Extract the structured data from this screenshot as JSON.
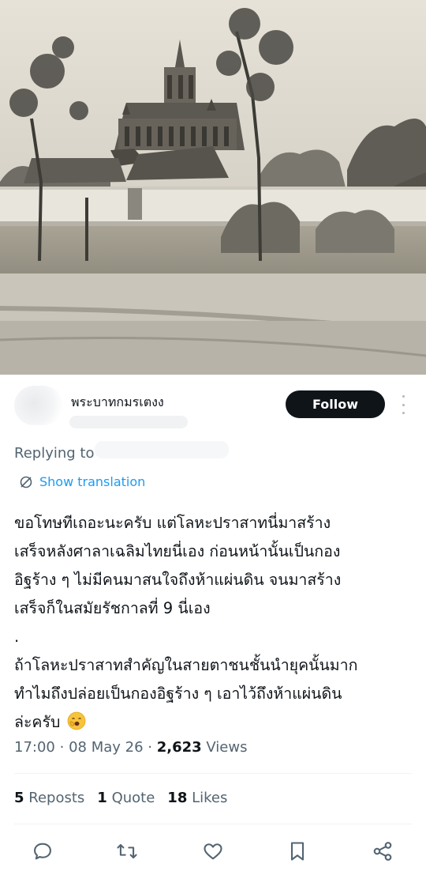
{
  "author": {
    "name": "พระบาทกมรเตงง"
  },
  "follow_label": "Follow",
  "replying_to": "Replying to",
  "show_translation": "Show translation",
  "tweet": {
    "line1": "ขอโทษทีเถอะนะครับ แต่โลหะปราสาทนี่มาสร้าง",
    "line2": "เสร็จหลังศาลาเฉลิมไทยนี่เอง ก่อนหน้านั้นเป็นกอง",
    "line3": "อิฐร้าง ๆ ไม่มีคนมาสนใจถึงห้าแผ่นดิน จนมาสร้าง",
    "line4": "เสร็จก็ในสมัยรัชกาลที่ 9 นี่เอง",
    "line5": ".",
    "line6": "ถ้าโลหะปราสาทสำคัญในสายตาชนชั้นนำยุคนั้นมาก",
    "line7": "ทำไมถึงปล่อยเป็นกองอิฐร้าง ๆ เอาไว้ถึงห้าแผ่นดิน",
    "line8": "ล่ะครับ"
  },
  "meta": {
    "time": "17:00",
    "date": "08 May 26",
    "views_count": "2,623",
    "views_label": "Views"
  },
  "stats": {
    "reposts_count": "5",
    "reposts_label": "Reposts",
    "quotes_count": "1",
    "quotes_label": "Quote",
    "likes_count": "18",
    "likes_label": "Likes"
  },
  "icons": [
    "reply-icon",
    "repost-icon",
    "like-icon",
    "bookmark-icon",
    "share-icon",
    "translate-icon",
    "yawning-emoji"
  ],
  "colors": {
    "link": "#1d9bf0",
    "text": "#0f1419",
    "muted": "#536471",
    "button": "#0f1419"
  }
}
